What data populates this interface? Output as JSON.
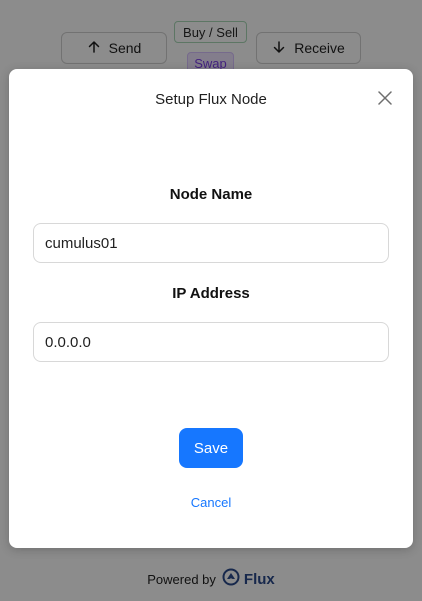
{
  "background": {
    "send_label": "Send",
    "receive_label": "Receive",
    "buy_sell_label": "Buy / Sell",
    "swap_label": "Swap",
    "footer_prefix": "Powered by",
    "footer_brand": "Flux"
  },
  "modal": {
    "title": "Setup Flux Node",
    "node_name_label": "Node Name",
    "node_name_value": "cumulus01",
    "ip_address_label": "IP Address",
    "ip_address_value": "0.0.0.0",
    "save_label": "Save",
    "cancel_label": "Cancel"
  },
  "colors": {
    "primary": "#1677ff",
    "swap_text": "#7a3ee6",
    "brand": "#2a4a8a"
  },
  "icons": {
    "send": "arrow-up-icon",
    "receive": "arrow-down-icon",
    "close": "close-icon",
    "brand_logo": "flux-logo-icon"
  }
}
